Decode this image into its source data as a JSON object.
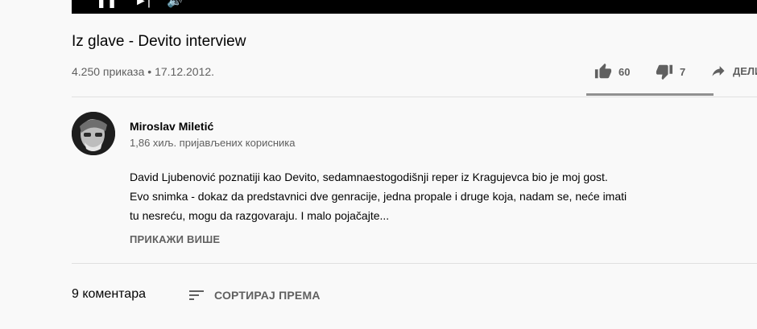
{
  "video": {
    "title": "Iz glave - Devito interview",
    "views": "4.250 приказа",
    "separator": "•",
    "date": "17.12.2012."
  },
  "actions": {
    "likes": "60",
    "dislikes": "7",
    "share_label": "ДЕЛИ"
  },
  "channel": {
    "name": "Miroslav Miletić",
    "subscribers": "1,86 хиљ. пријављених корисника"
  },
  "description": {
    "lines": [
      "David Ljubenović poznatiji kao Devito, sedamnaestogodišnji reper iz Kragujevca bio je moj gost.",
      "Evo snimka - dokaz da predstavnici dve genracije, jedna propale i druge koja, nadam se, neće imati",
      "tu nesreću, mogu da razgovaraju. I malo pojačajte..."
    ],
    "show_more": "ПРИКАЖИ ВИШЕ"
  },
  "comments": {
    "count_label": "9 коментара",
    "sort_label": "СОРТИРАЈ ПРЕМА"
  },
  "icons": {
    "like": "thumb-up-icon",
    "dislike": "thumb-down-icon",
    "share": "share-icon",
    "sort": "sort-icon"
  },
  "colors": {
    "background": "#f9f9f9",
    "text_primary": "#030303",
    "text_secondary": "#606060",
    "divider": "#e0e0e0",
    "sentiment_bar": "#909090"
  }
}
